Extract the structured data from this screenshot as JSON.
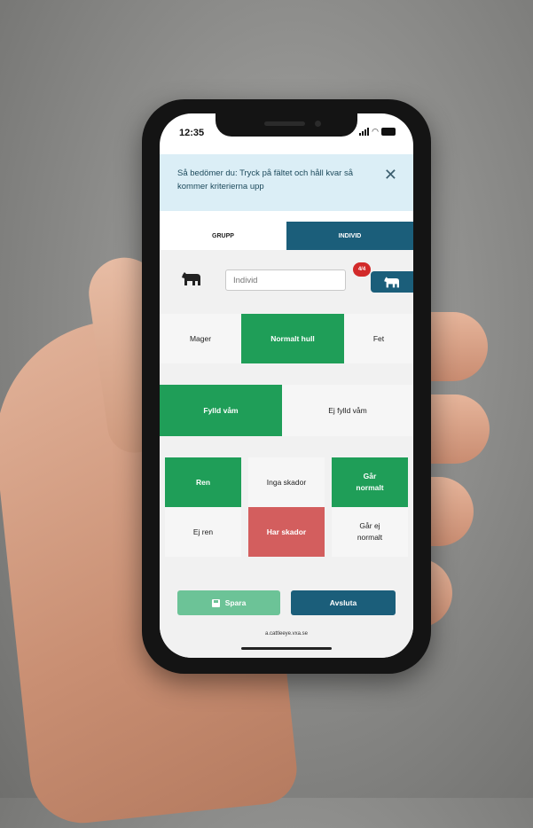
{
  "status_bar": {
    "time": "12:35"
  },
  "info_banner": {
    "text": "Så bedömer du: Tryck på fältet och håll kvar så kommer kriterierna upp"
  },
  "tabs": [
    {
      "label": "GRUPP",
      "selected": false
    },
    {
      "label": "INDIVID",
      "selected": true
    }
  ],
  "individual": {
    "placeholder": "Individ",
    "badge": "4/4"
  },
  "criteria": {
    "body_condition": [
      "Mager",
      "Normalt hull",
      "Fet"
    ],
    "rumen": [
      "Fylld våm",
      "Ej fylld våm"
    ],
    "cleanliness": [
      "Ren",
      "Ej ren"
    ],
    "injuries": [
      "Inga skador",
      "Har skador"
    ],
    "gait": [
      "Går normalt",
      "Går ej normalt"
    ]
  },
  "actions": {
    "save_label": "Spara",
    "finish_label": "Avsluta"
  },
  "footer": {
    "url": "a.cattleeye.vxa.se"
  },
  "colors": {
    "selected_green": "#1f9e58",
    "selected_red": "#d35e5e",
    "primary_blue": "#1b5e7a",
    "save_green": "#6cc397",
    "banner_bg": "#dbeef6"
  }
}
